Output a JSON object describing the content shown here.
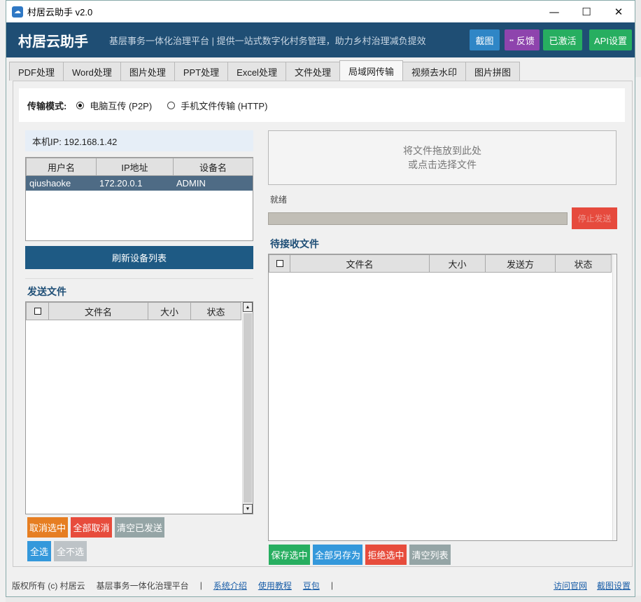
{
  "window": {
    "title": "村居云助手 v2.0",
    "controls": [
      "—",
      "☐",
      "✕"
    ]
  },
  "header": {
    "brand": "村居云助手",
    "slogan": "基层事务一体化治理平台 | 提供一站式数字化村务管理，助力乡村治理减负提效",
    "buttons": {
      "screenshot": "截图",
      "feedback": "反馈",
      "activated": "已激活",
      "api_settings": "API设置"
    },
    "colors": {
      "bar": "#1f4e74",
      "screenshot": "#2f86c6",
      "feedback": "#8e44ad",
      "activated": "#27ae60",
      "api": "#27ae60"
    }
  },
  "tabs": [
    "PDF处理",
    "Word处理",
    "图片处理",
    "PPT处理",
    "Excel处理",
    "文件处理",
    "局域网传输",
    "视频去水印",
    "图片拼图"
  ],
  "active_tab": "局域网传输",
  "mode": {
    "label": "传输模式:",
    "options": [
      "电脑互传 (P2P)",
      "手机文件传输 (HTTP)"
    ],
    "selected": "电脑互传 (P2P)"
  },
  "local_ip": "本机IP: 192.168.1.42",
  "devices": {
    "columns": [
      "用户名",
      "IP地址",
      "设备名"
    ],
    "rows": [
      {
        "user": "qiushaoke",
        "ip": "172.20.0.1",
        "device": "ADMIN"
      }
    ]
  },
  "refresh_button": "刷新设备列表",
  "send": {
    "title": "发送文件",
    "columns": [
      "文件名",
      "大小",
      "状态"
    ],
    "buttons": {
      "unselect": "取消选中",
      "unselect_all": "全部取消",
      "clear_sent": "清空已发送",
      "select_all": "全选",
      "select_none": "全不选"
    }
  },
  "drop_zone": {
    "line1": "将文件拖放到此处",
    "line2": "或点击选择文件"
  },
  "status_text": "就绪",
  "stop_button": "停止发送",
  "receive": {
    "title": "待接收文件",
    "columns": [
      "文件名",
      "大小",
      "发送方",
      "状态"
    ],
    "buttons": {
      "save_selected": "保存选中",
      "save_all": "全部另存为",
      "reject_selected": "拒绝选中",
      "clear_list": "清空列表"
    }
  },
  "footer": {
    "copyright": "版权所有 (c) 村居云",
    "platform": "基层事务一体化治理平台",
    "sep": "|",
    "links": [
      "系统介绍",
      "使用教程",
      "豆包"
    ],
    "right_links": [
      "访问官网",
      "截图设置"
    ]
  }
}
